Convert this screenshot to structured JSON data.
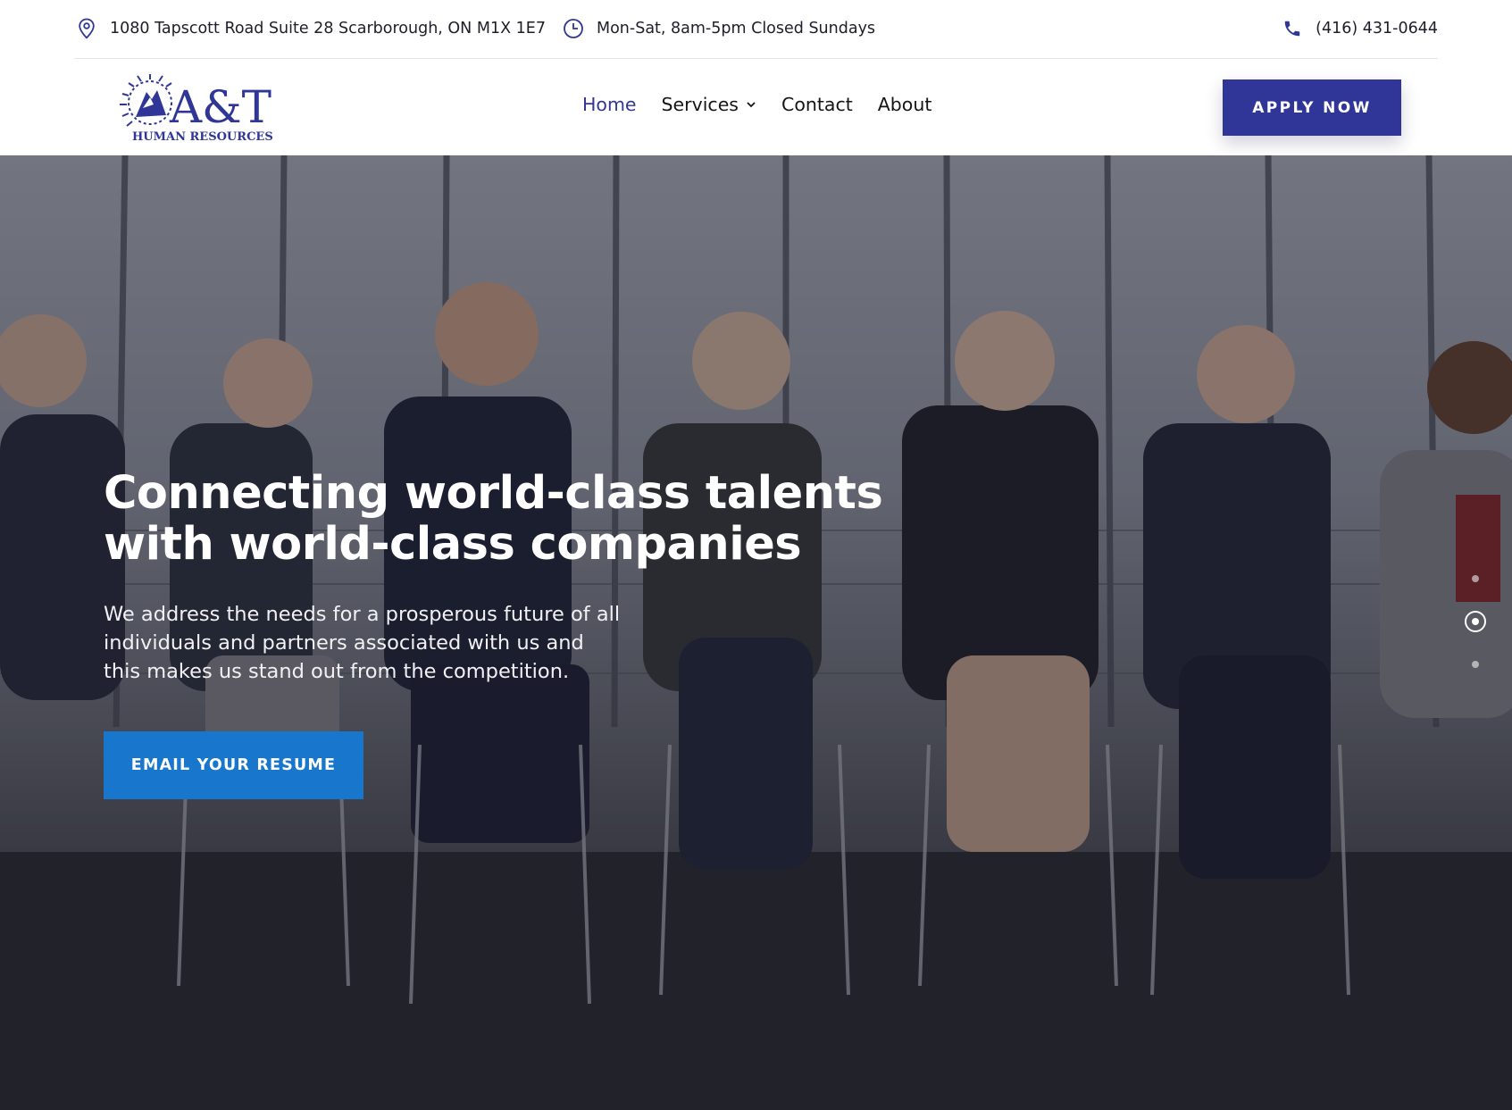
{
  "topbar": {
    "address": "1080 Tapscott Road Suite 28 Scarborough, ON M1X 1E7",
    "hours": "Mon-Sat, 8am-5pm Closed Sundays",
    "phone": "(416) 431-0644",
    "address_icon": "map-pin-icon",
    "hours_icon": "clock-icon",
    "phone_icon": "phone-icon"
  },
  "logo": {
    "mark": "A&T",
    "subtitle": "HUMAN RESOURCES"
  },
  "nav": {
    "items": [
      {
        "label": "Home",
        "active": true
      },
      {
        "label": "Services",
        "has_dropdown": true
      },
      {
        "label": "Contact"
      },
      {
        "label": "About"
      }
    ]
  },
  "header": {
    "apply_label": "APPLY NOW"
  },
  "hero": {
    "heading_line1": "Connecting world-class talents",
    "heading_line2": "with world-class companies",
    "body": "We address the needs for a prosperous future of all individuals and partners associated with us and this makes us stand out from the competition.",
    "cta_label": "EMAIL YOUR RESUME",
    "slides_count": 3,
    "active_slide": 2
  },
  "colors": {
    "brand_navy": "#2f3697",
    "nav_active": "#323798",
    "cta_blue": "#1877cd",
    "text_dark": "#1e1e2a"
  }
}
